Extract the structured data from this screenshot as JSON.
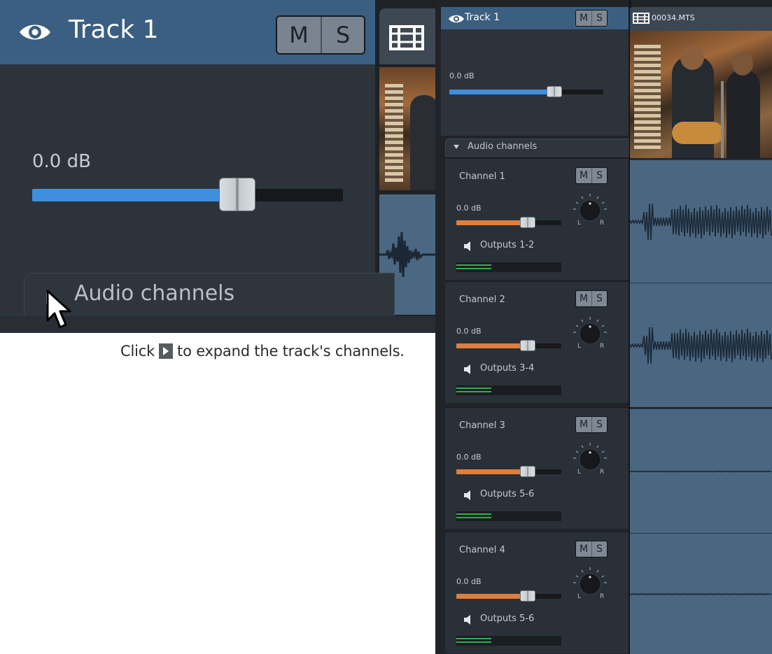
{
  "zoom": {
    "track_title": "Track 1",
    "mute_label": "M",
    "solo_label": "S",
    "volume_text": "0.0 dB",
    "volume_level": 0.66,
    "audio_channels_label": "Audio channels"
  },
  "caption": {
    "before": "Click",
    "after": "to expand the track's channels."
  },
  "panel": {
    "track_title": "Track 1",
    "mute_label": "M",
    "solo_label": "S",
    "volume_text": "0.0 dB",
    "volume_level": 0.68,
    "audio_channels_label": "Audio channels",
    "clip_name": "00034.MTS",
    "channels": [
      {
        "name": "Channel 1",
        "volume_text": "0.0 dB",
        "level": 0.68,
        "output": "Outputs 1-2",
        "pan_left": "L",
        "pan_right": "R",
        "mute": "M",
        "solo": "S"
      },
      {
        "name": "Channel 2",
        "volume_text": "0.0 dB",
        "level": 0.68,
        "output": "Outputs 3-4",
        "pan_left": "L",
        "pan_right": "R",
        "mute": "M",
        "solo": "S"
      },
      {
        "name": "Channel 3",
        "volume_text": "0.0 dB",
        "level": 0.68,
        "output": "Outputs 5-6",
        "pan_left": "L",
        "pan_right": "R",
        "mute": "M",
        "solo": "S"
      },
      {
        "name": "Channel 4",
        "volume_text": "0.0 dB",
        "level": 0.68,
        "output": "Outputs 5-6",
        "pan_left": "L",
        "pan_right": "R",
        "mute": "M",
        "solo": "S"
      }
    ]
  },
  "colors": {
    "track_volume": "#3f8fde",
    "channel_volume": "#e07f3d",
    "meter": "#2fb04a"
  }
}
